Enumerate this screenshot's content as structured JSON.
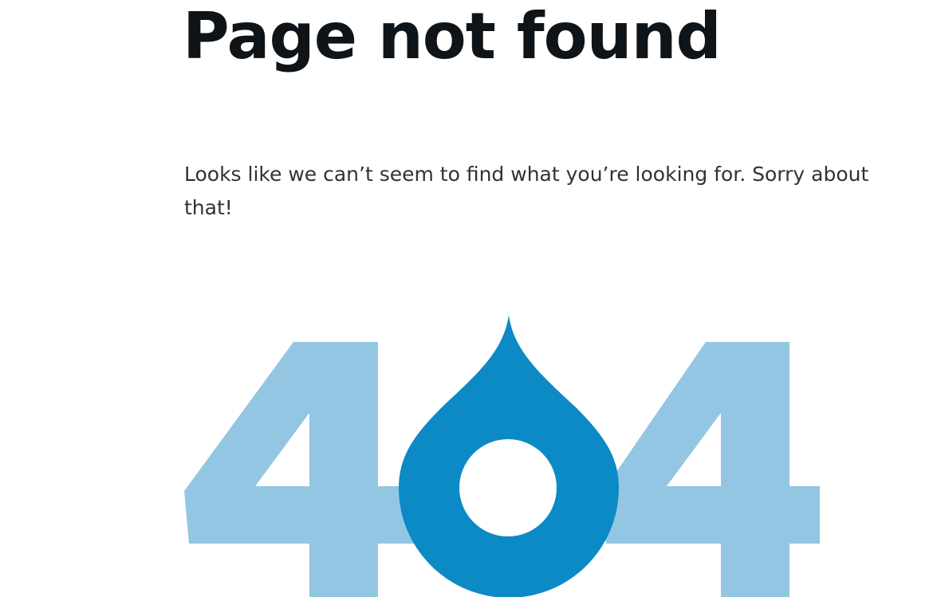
{
  "page": {
    "title": "Page not found",
    "message": "Looks like we can’t seem to find what you’re looking for. Sorry about that!"
  },
  "illustration": {
    "label": "404",
    "icon": "drupal-drop-icon",
    "colors": {
      "digit": "#93c6e2",
      "drop": "#0b8ac6",
      "hole": "#ffffff"
    }
  }
}
